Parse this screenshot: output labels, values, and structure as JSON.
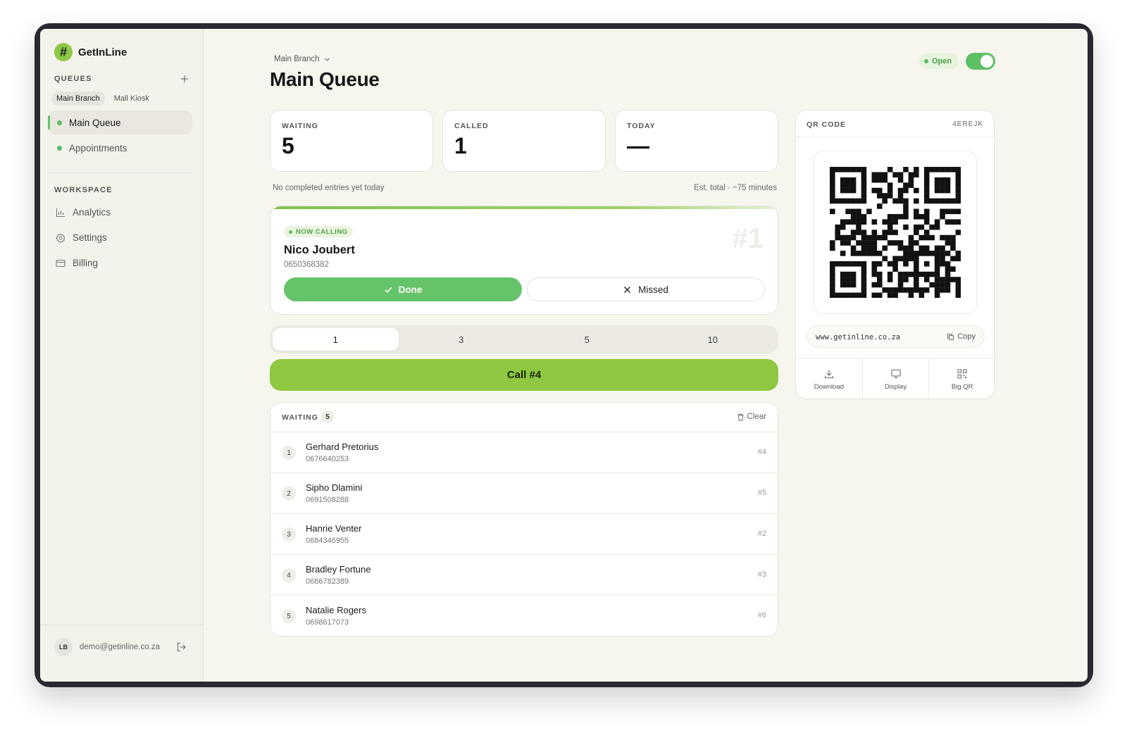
{
  "brand": {
    "logo": "#",
    "name": "GetInLine"
  },
  "sidebar": {
    "queues_label": "QUEUES",
    "add_icon": "plus-icon",
    "branches": [
      {
        "label": "Main Branch",
        "active": true
      },
      {
        "label": "Mall Kiosk",
        "active": false
      }
    ],
    "queues": [
      {
        "label": "Main Queue",
        "active": true
      },
      {
        "label": "Appointments",
        "active": false
      }
    ],
    "workspace_label": "WORKSPACE",
    "workspace": [
      {
        "label": "Analytics",
        "icon": "bar-chart-icon"
      },
      {
        "label": "Settings",
        "icon": "gear-icon"
      },
      {
        "label": "Billing",
        "icon": "credit-card-icon"
      }
    ],
    "user": {
      "initials": "LB",
      "email": "demo@getinline.co.za"
    }
  },
  "header": {
    "breadcrumb": "Main Branch",
    "title": "Main Queue",
    "status": "Open",
    "toggle_on": true
  },
  "stats": [
    {
      "label": "WAITING",
      "value": "5"
    },
    {
      "label": "CALLED",
      "value": "1"
    },
    {
      "label": "TODAY",
      "value": "—"
    }
  ],
  "notes": {
    "left": "No completed entries yet today",
    "right": "Est. total · ~75 minutes"
  },
  "now_calling": {
    "badge": "NOW CALLING",
    "name": "Nico Joubert",
    "phone": "0650368382",
    "ticket": "#1",
    "done_label": "Done",
    "missed_label": "Missed"
  },
  "batch_options": [
    "1",
    "3",
    "5",
    "10"
  ],
  "batch_selected": "1",
  "call_button": "Call #4",
  "waiting": {
    "title": "WAITING",
    "count": "5",
    "clear_label": "Clear",
    "rows": [
      {
        "idx": "1",
        "name": "Gerhard Pretorius",
        "phone": "0676640253",
        "ticket": "#4"
      },
      {
        "idx": "2",
        "name": "Sipho Dlamini",
        "phone": "0691508288",
        "ticket": "#5"
      },
      {
        "idx": "3",
        "name": "Hanrie Venter",
        "phone": "0684346955",
        "ticket": "#2"
      },
      {
        "idx": "4",
        "name": "Bradley Fortune",
        "phone": "0686782389",
        "ticket": "#3"
      },
      {
        "idx": "5",
        "name": "Natalie Rogers",
        "phone": "0698617073",
        "ticket": "#6"
      }
    ]
  },
  "qr": {
    "title": "QR CODE",
    "code_id": "4EREJK",
    "url": "www.getinline.co.za",
    "copy_label": "Copy",
    "actions": [
      {
        "label": "Download",
        "icon": "download-icon"
      },
      {
        "label": "Display",
        "icon": "monitor-icon"
      },
      {
        "label": "Big QR",
        "icon": "qr-icon"
      }
    ]
  },
  "colors": {
    "accent_green": "#65c36a",
    "call_green": "#8dc840",
    "background": "#f6f5ee"
  }
}
